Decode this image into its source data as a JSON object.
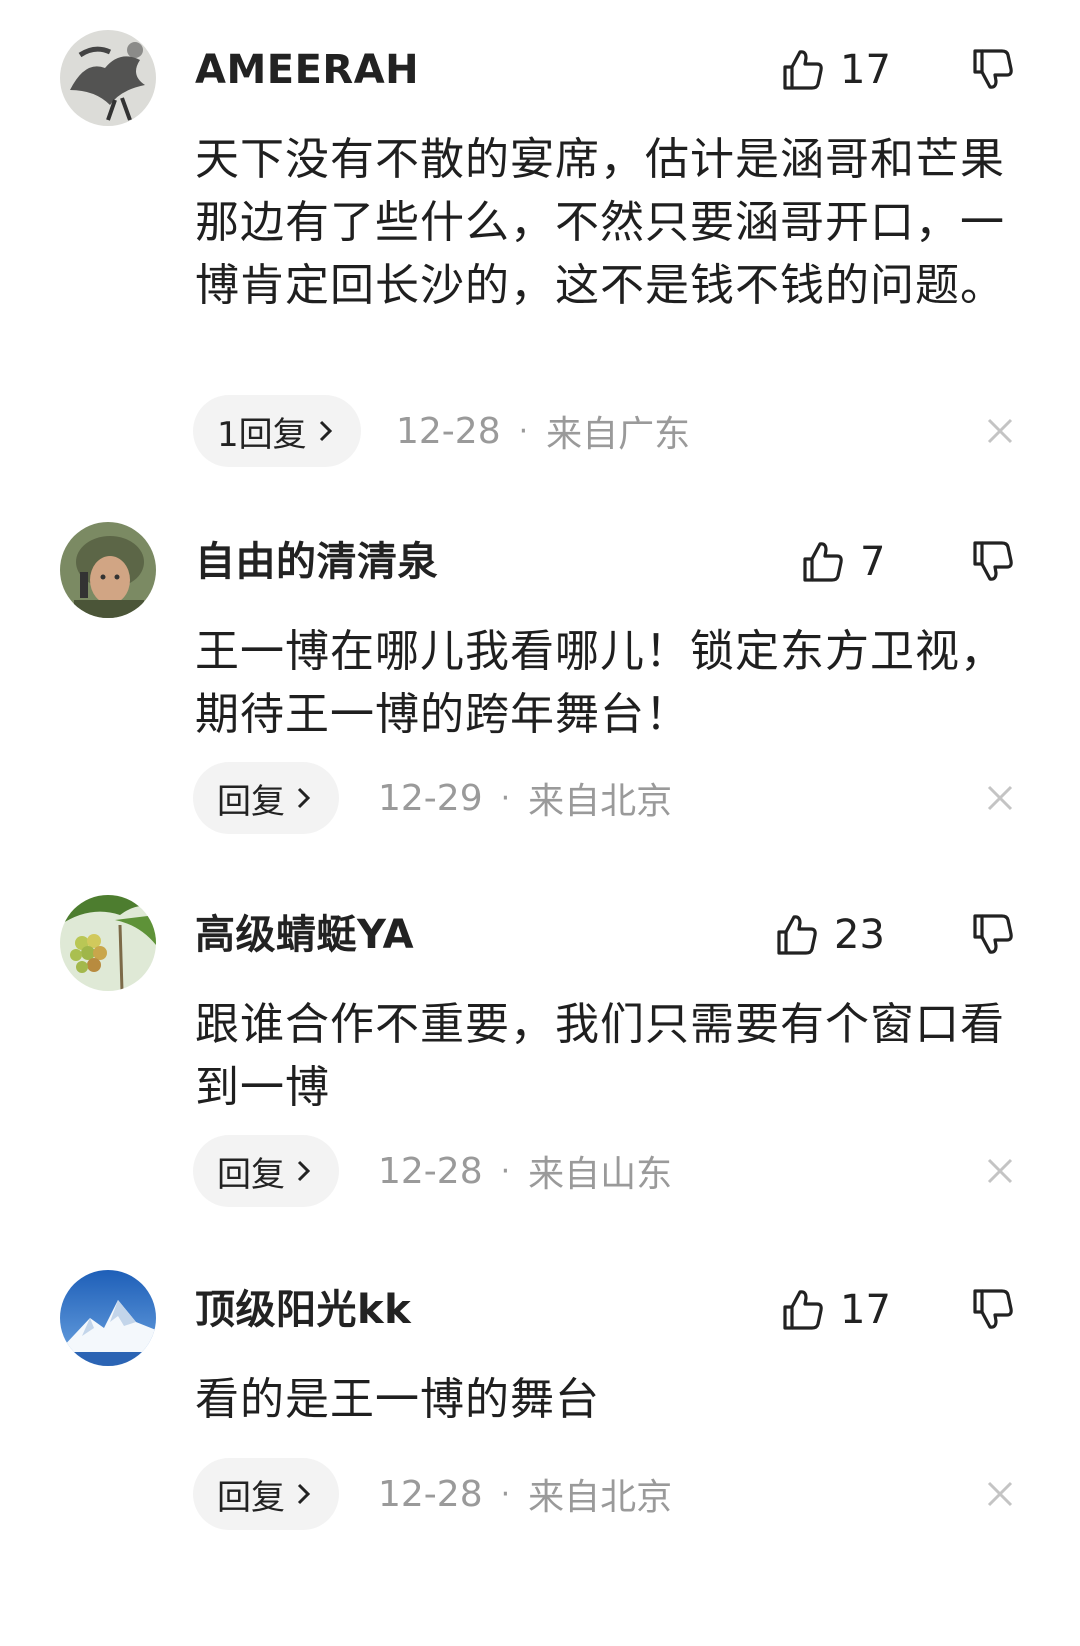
{
  "comments": [
    {
      "username": "AMEERAH",
      "likes": "17",
      "text": "天下没有不散的宴席，估计是涵哥和芒果那边有了些什么，不然只要涵哥开口，一博肯定回长沙的，这不是钱不钱的问题。",
      "reply_label": "1回复",
      "date": "12-28",
      "separator": "·",
      "location": "来自广东",
      "avatar_icon": "ink-horse-painting-avatar",
      "avatar_colors": [
        "#d9d9d6",
        "#4a4a4a"
      ]
    },
    {
      "username": "自由的清清泉",
      "likes": "7",
      "text": "王一博在哪儿我看哪儿！锁定东方卫视，期待王一博的跨年舞台！",
      "reply_label": "回复",
      "date": "12-29",
      "separator": "·",
      "location": "来自北京",
      "avatar_icon": "person-in-helmet-avatar",
      "avatar_colors": [
        "#6f7c5a",
        "#c9a27f"
      ]
    },
    {
      "username": "高级蜻蜓YA",
      "likes": "23",
      "text": "跟谁合作不重要，我们只需要有个窗口看到一博",
      "reply_label": "回复",
      "date": "12-28",
      "separator": "·",
      "location": "来自山东",
      "avatar_icon": "grapes-vine-avatar",
      "avatar_colors": [
        "#5f8f3a",
        "#cfd36a"
      ]
    },
    {
      "username": "顶级阳光kk",
      "likes": "17",
      "text": "看的是王一博的舞台",
      "reply_label": "回复",
      "date": "12-28",
      "separator": "·",
      "location": "来自北京",
      "avatar_icon": "snow-mountain-avatar",
      "avatar_colors": [
        "#2e6fc2",
        "#ffffff"
      ]
    }
  ],
  "icons": {
    "like": "thumbs-up-outline-icon",
    "dislike": "thumbs-down-outline-icon",
    "reply_chevron": "chevron-right-icon",
    "dismiss": "close-icon"
  },
  "colors": {
    "text_primary": "#1f1f1f",
    "text_secondary": "#9a9a9a",
    "reply_pill_bg": "#f3f3f3",
    "icon_stroke": "#222222",
    "dismiss_icon": "#c4c4c4"
  }
}
